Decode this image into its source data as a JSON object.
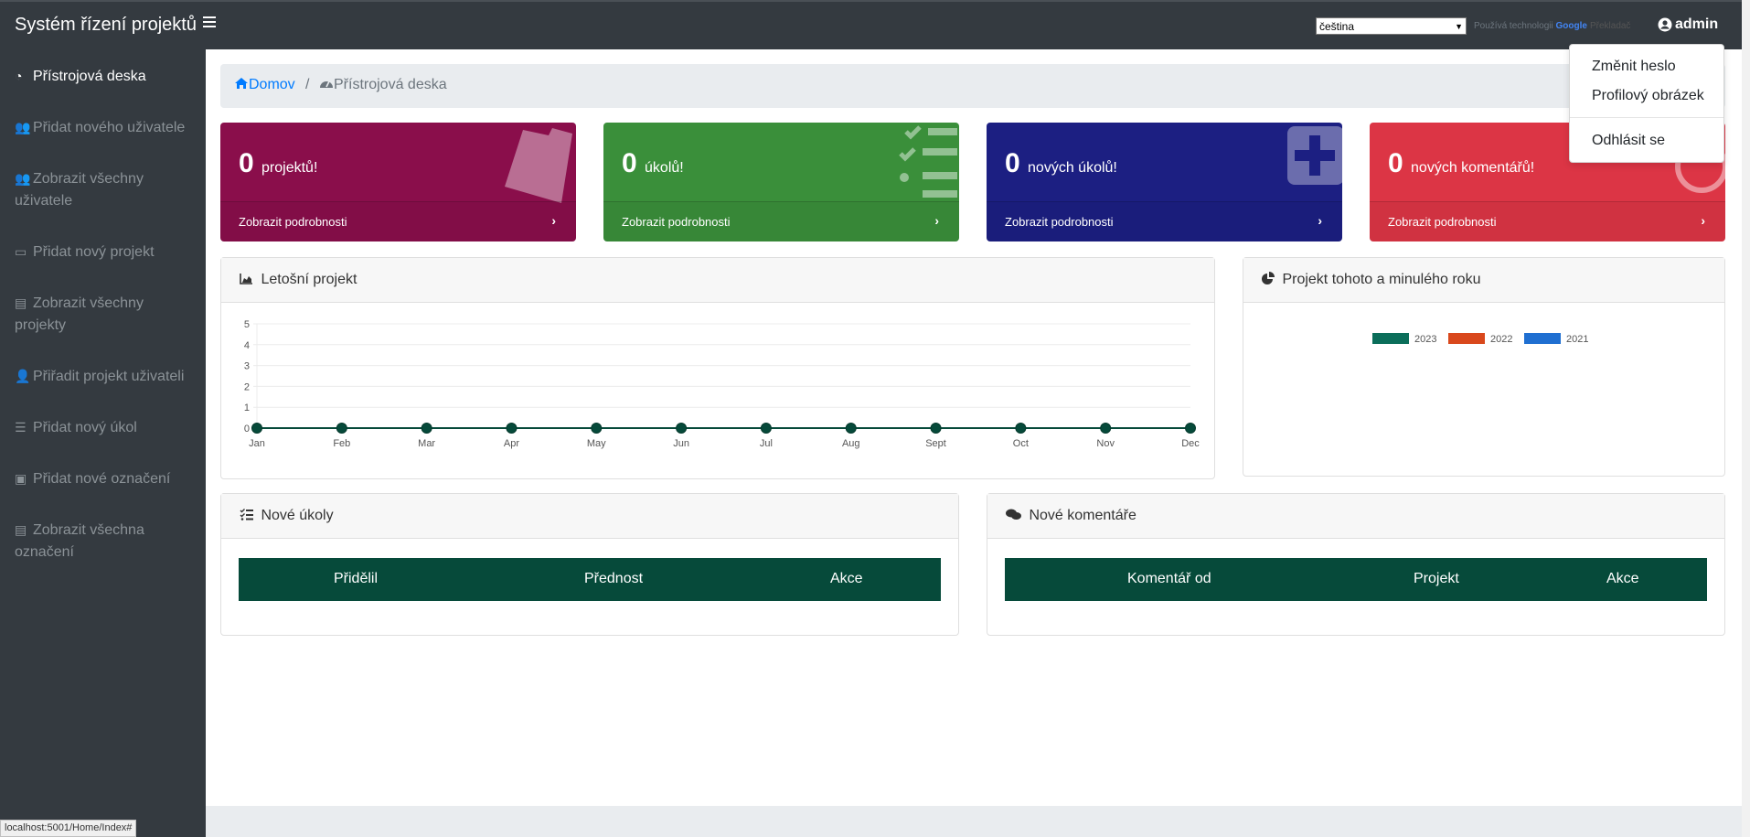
{
  "app": {
    "title": "Systém řízení projektů"
  },
  "topbar": {
    "language": "čeština",
    "powered_by": "Používá technologii",
    "google": "Google",
    "translate": "Překladač",
    "user": "admin"
  },
  "sidebar": {
    "items": [
      {
        "label": "Přístrojová deska",
        "icon": "tachometer-icon",
        "active": true
      },
      {
        "label": "Přidat nového uživatele",
        "icon": "users-icon"
      },
      {
        "label": "Zobrazit všechny uživatele",
        "icon": "users-icon"
      },
      {
        "label": "Přidat nový projekt",
        "icon": "folder-open-icon"
      },
      {
        "label": "Zobrazit všechny projekty",
        "icon": "list-icon"
      },
      {
        "label": "Přiřadit projekt uživateli",
        "icon": "user-edit-icon"
      },
      {
        "label": "Přidat nový úkol",
        "icon": "tasks-icon"
      },
      {
        "label": "Přidat nové označení",
        "icon": "toolbox-icon"
      },
      {
        "label": "Zobrazit všechna označení",
        "icon": "list-icon"
      }
    ]
  },
  "breadcrumb": {
    "home": "Domov",
    "separator": "/",
    "current": "Přístrojová deska"
  },
  "cards": [
    {
      "count": "0",
      "label": "projektů!",
      "footer": "Zobrazit podrobnosti",
      "color": "#8a0e4b",
      "icon": "folder-icon"
    },
    {
      "count": "0",
      "label": "úkolů!",
      "footer": "Zobrazit podrobnosti",
      "color": "#3a8f3a",
      "icon": "checklist-icon"
    },
    {
      "count": "0",
      "label": "nových úkolů!",
      "footer": "Zobrazit podrobnosti",
      "color": "#1c1f82",
      "icon": "plus-square-icon"
    },
    {
      "count": "0",
      "label": "nových komentářů!",
      "footer": "Zobrazit podrobnosti",
      "color": "#dc3545",
      "icon": "comment-icon"
    }
  ],
  "panels": {
    "yearly": {
      "title": "Letošní projekt"
    },
    "compare": {
      "title": "Projekt tohoto a minulého roku"
    },
    "tasks": {
      "title": "Nové úkoly",
      "columns": [
        "Přidělil",
        "Přednost",
        "Akce"
      ]
    },
    "comments": {
      "title": "Nové komentáře",
      "columns": [
        "Komentář od",
        "Projekt",
        "Akce"
      ]
    }
  },
  "chart_data": [
    {
      "type": "line",
      "title": "Letošní projekt",
      "categories": [
        "Jan",
        "Feb",
        "Mar",
        "Apr",
        "May",
        "Jun",
        "Jul",
        "Aug",
        "Sept",
        "Oct",
        "Nov",
        "Dec"
      ],
      "values": [
        0,
        0,
        0,
        0,
        0,
        0,
        0,
        0,
        0,
        0,
        0,
        0
      ],
      "ylim": [
        0,
        5
      ],
      "yticks": [
        "0",
        "1",
        "2",
        "3",
        "4",
        "5"
      ],
      "grid": true,
      "line_color": "#064a3a"
    },
    {
      "type": "pie",
      "title": "Projekt tohoto a minulého roku",
      "legend": [
        {
          "name": "2023",
          "color": "#0b6e5a"
        },
        {
          "name": "2022",
          "color": "#d9481c"
        },
        {
          "name": "2021",
          "color": "#1f6fd1"
        }
      ],
      "legend_position": "top",
      "values": []
    }
  ],
  "dropdown": {
    "items": [
      "Změnit heslo",
      "Profilový obrázek",
      "Odhlásit se"
    ]
  },
  "status_url": "localhost:5001/Home/Index#"
}
